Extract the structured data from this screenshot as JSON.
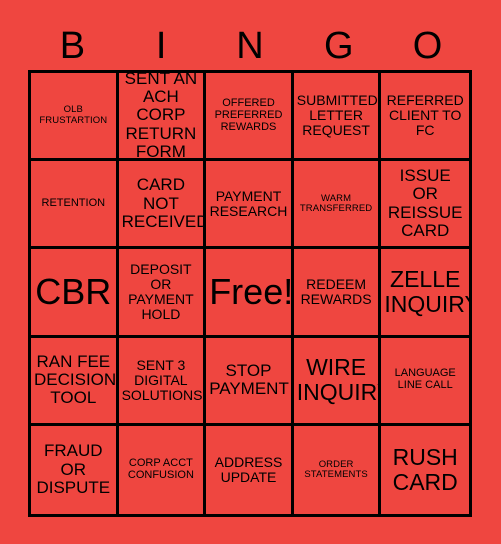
{
  "card": {
    "title": "BINGO",
    "background_color": "#EF4640",
    "border_color": "#000000",
    "text_color": "#000000",
    "header_letters": [
      "B",
      "I",
      "N",
      "G",
      "O"
    ],
    "columns": 5,
    "rows": 5,
    "cells": [
      {
        "text": "OLB\nFRUSTARTION",
        "size": "sz-xs"
      },
      {
        "text": "SENT AN\nACH CORP\nRETURN\nFORM",
        "size": "sz-lg"
      },
      {
        "text": "OFFERED\nPREFERRED\nREWARDS",
        "size": "sz-sm"
      },
      {
        "text": "SUBMITTED\nLETTER\nREQUEST",
        "size": "sz-md"
      },
      {
        "text": "REFERRED\nCLIENT TO\nFC",
        "size": "sz-md"
      },
      {
        "text": "RETENTION",
        "size": "sz-sm"
      },
      {
        "text": "CARD\nNOT\nRECEIVED",
        "size": "sz-lg"
      },
      {
        "text": "PAYMENT\nRESEARCH",
        "size": "sz-md"
      },
      {
        "text": "WARM\nTRANSFERRED",
        "size": "sz-xs"
      },
      {
        "text": "ISSUE\nOR\nREISSUE\nCARD",
        "size": "sz-lg"
      },
      {
        "text": "CBR",
        "size": "sz-xxl"
      },
      {
        "text": "DEPOSIT\nOR\nPAYMENT\nHOLD",
        "size": "sz-md"
      },
      {
        "text": "Free!",
        "size": "sz-xxl"
      },
      {
        "text": "REDEEM\nREWARDS",
        "size": "sz-md"
      },
      {
        "text": "ZELLE\nINQUIRY",
        "size": "sz-xl"
      },
      {
        "text": "RAN FEE\nDECISION\nTOOL",
        "size": "sz-lg"
      },
      {
        "text": "SENT 3\nDIGITAL\nSOLUTIONS",
        "size": "sz-md"
      },
      {
        "text": "STOP\nPAYMENT",
        "size": "sz-lg"
      },
      {
        "text": "WIRE\nINQUIRY",
        "size": "sz-xl"
      },
      {
        "text": "LANGUAGE\nLINE CALL",
        "size": "sz-sm"
      },
      {
        "text": "FRAUD\nOR\nDISPUTE",
        "size": "sz-lg"
      },
      {
        "text": "CORP ACCT\nCONFUSION",
        "size": "sz-sm"
      },
      {
        "text": "ADDRESS\nUPDATE",
        "size": "sz-md"
      },
      {
        "text": "ORDER\nSTATEMENTS",
        "size": "sz-xs"
      },
      {
        "text": "RUSH\nCARD",
        "size": "sz-xl"
      }
    ]
  }
}
